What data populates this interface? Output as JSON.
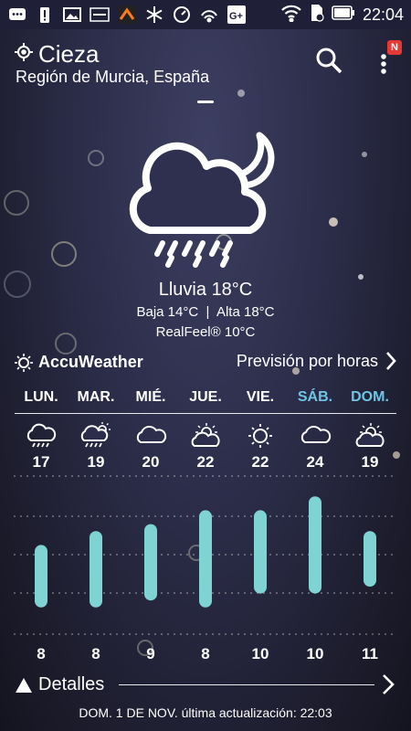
{
  "status_bar": {
    "time": "22:04"
  },
  "header": {
    "city": "Cieza",
    "region": "Región de Murcia, España",
    "notification_badge": "N"
  },
  "current": {
    "condition": "Lluvia",
    "temp": "18°C",
    "low": "Baja 14°C",
    "separator": "|",
    "high": "Alta 18°C",
    "realfeel": "RealFeel® 10°C"
  },
  "provider": {
    "name": "AccuWeather",
    "hourly_link": "Previsión por horas"
  },
  "forecast": {
    "days": [
      {
        "label": "LUN.",
        "icon": "rain-icon",
        "high": 17,
        "low": 8,
        "weekend": false
      },
      {
        "label": "MAR.",
        "icon": "sun-rain-icon",
        "high": 19,
        "low": 8,
        "weekend": false
      },
      {
        "label": "MIÉ.",
        "icon": "cloud-icon",
        "high": 20,
        "low": 9,
        "weekend": false
      },
      {
        "label": "JUE.",
        "icon": "partly-sunny-icon",
        "high": 22,
        "low": 8,
        "weekend": false
      },
      {
        "label": "VIE.",
        "icon": "sun-icon",
        "high": 22,
        "low": 10,
        "weekend": false
      },
      {
        "label": "SÁB.",
        "icon": "cloud-icon",
        "high": 24,
        "low": 10,
        "weekend": true
      },
      {
        "label": "DOM.",
        "icon": "partly-sunny-icon",
        "high": 19,
        "low": 11,
        "weekend": true
      }
    ],
    "temp_range": [
      6,
      26
    ]
  },
  "footer": {
    "details_label": "Detalles",
    "updated": "DOM. 1 DE NOV. última actualización: 22:03"
  },
  "colors": {
    "bar": "#7fd3d3",
    "weekend": "#6ec6e6",
    "badge": "#e53935"
  }
}
